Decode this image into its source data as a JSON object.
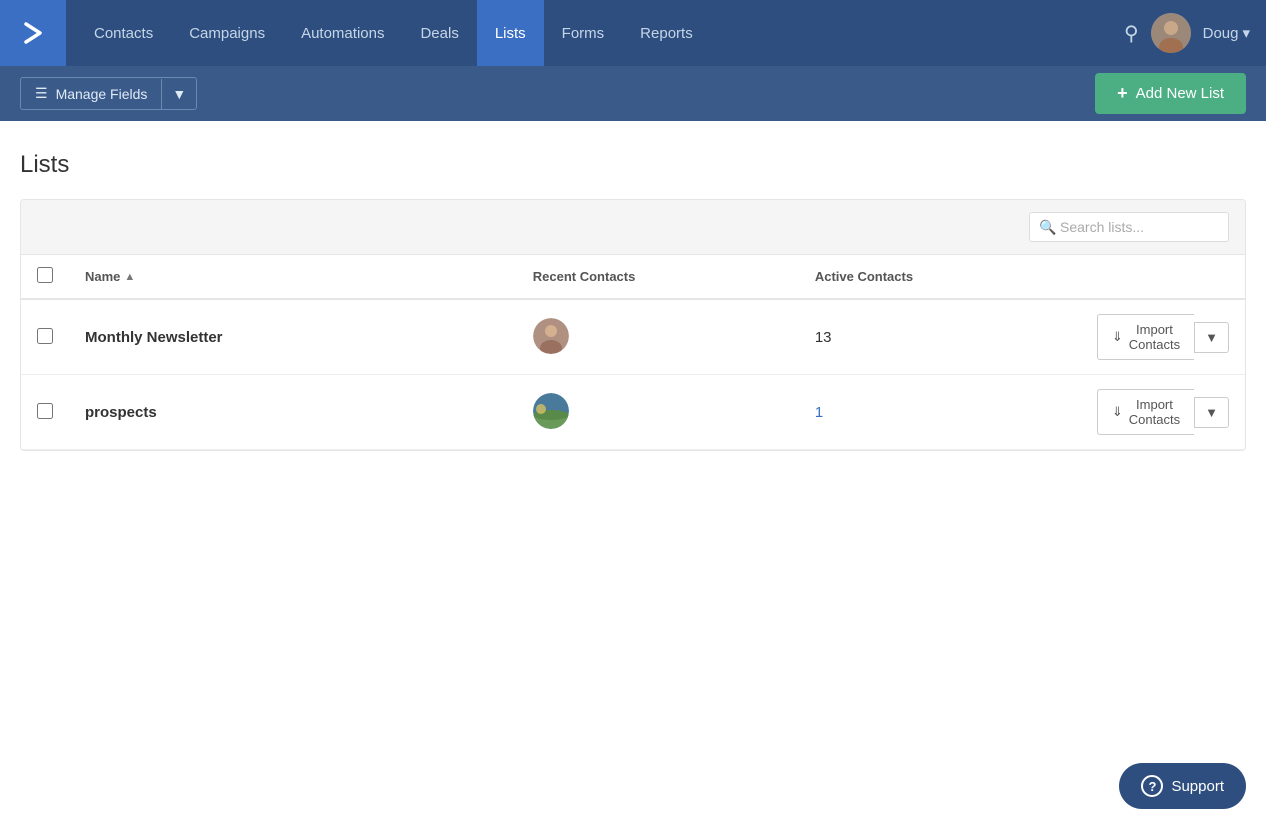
{
  "nav": {
    "logo_icon": "chevron-right",
    "items": [
      {
        "label": "Contacts",
        "active": false
      },
      {
        "label": "Campaigns",
        "active": false
      },
      {
        "label": "Automations",
        "active": false
      },
      {
        "label": "Deals",
        "active": false
      },
      {
        "label": "Lists",
        "active": true
      },
      {
        "label": "Forms",
        "active": false
      },
      {
        "label": "Reports",
        "active": false
      }
    ],
    "user_name": "Doug",
    "user_dropdown": "▾"
  },
  "sub_toolbar": {
    "manage_fields_label": "Manage Fields",
    "add_new_list_label": "Add New List",
    "add_icon": "+"
  },
  "main": {
    "page_title": "Lists",
    "search_placeholder": "Search lists...",
    "columns": {
      "name": "Name",
      "recent_contacts": "Recent Contacts",
      "active_contacts": "Active Contacts"
    },
    "lists": [
      {
        "id": 1,
        "name": "Monthly Newsletter",
        "recent_contacts_avatar": "person",
        "active_contacts": "13",
        "active_contacts_color": "dark",
        "import_label": "Import Contacts"
      },
      {
        "id": 2,
        "name": "prospects",
        "recent_contacts_avatar": "landscape",
        "active_contacts": "1",
        "active_contacts_color": "blue",
        "import_label": "Import Contacts"
      }
    ]
  },
  "support": {
    "label": "Support"
  }
}
